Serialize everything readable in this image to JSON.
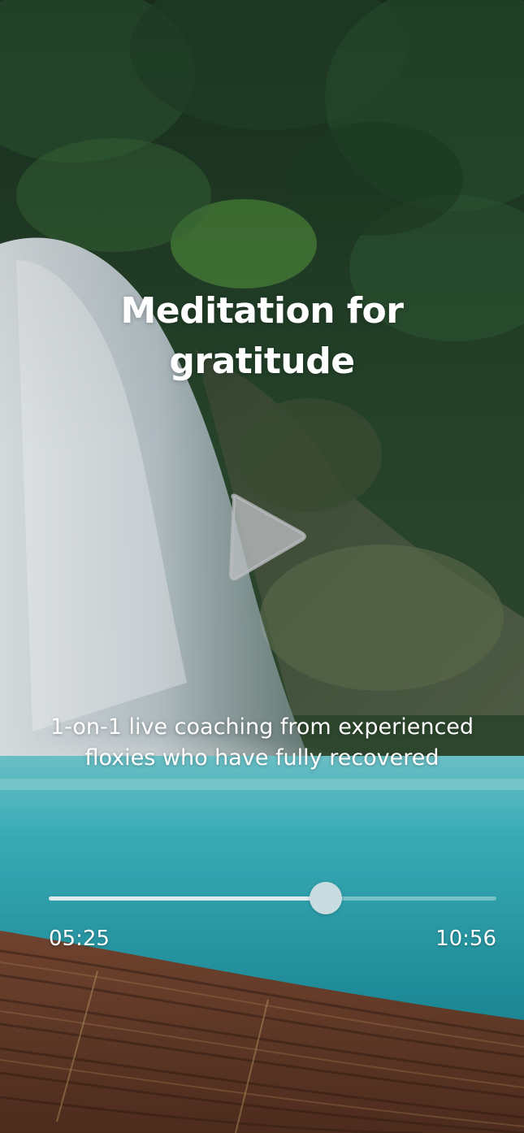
{
  "player": {
    "title": "Meditation for gratitude",
    "description": "1-on-1 live coaching from experienced floxies who have fully recovered",
    "elapsed_time": "05:25",
    "total_time": "10:56",
    "progress_fraction": 0.618,
    "play_icon": "play-icon"
  },
  "colors": {
    "text": "#ffffff",
    "progress_fill": "#ebf0f2",
    "progress_thumb": "#c9dde0",
    "water": "#2fb7c2",
    "foliage": "#1e3a24"
  }
}
